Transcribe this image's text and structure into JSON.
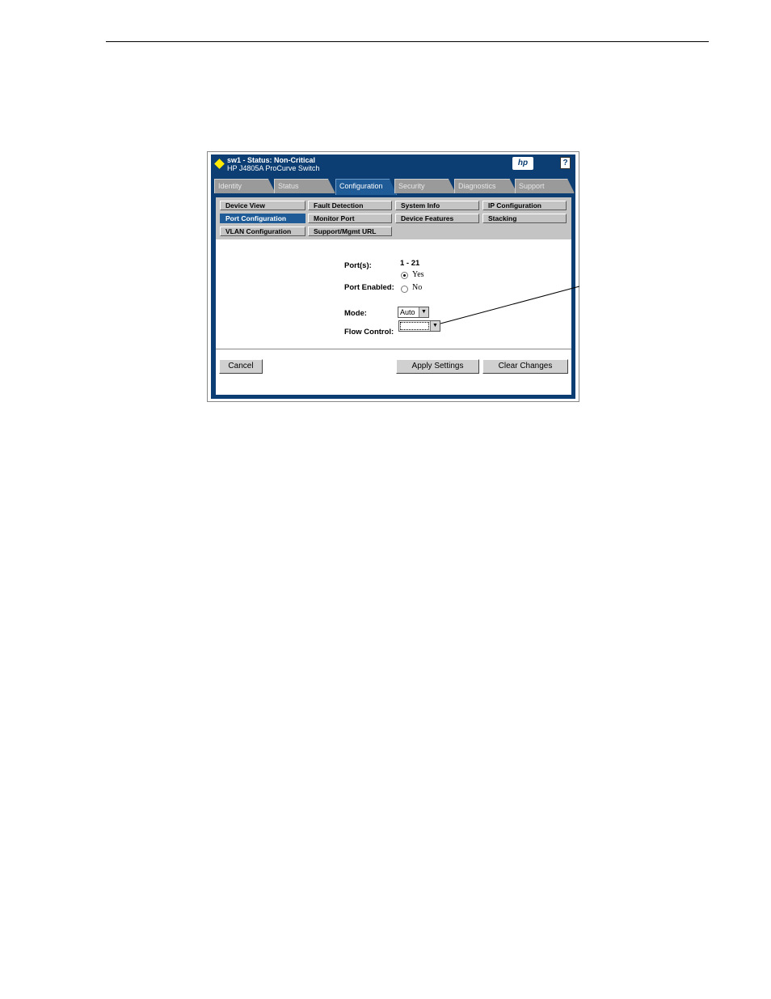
{
  "header": {
    "title": "sw1 - Status: Non-Critical",
    "subtitle": "HP J4805A ProCurve Switch",
    "logo": "hp",
    "help": "?",
    "status_color": "#ffea00"
  },
  "tabs": [
    {
      "label": "Identity",
      "active": false
    },
    {
      "label": "Status",
      "active": false
    },
    {
      "label": "Configuration",
      "active": true
    },
    {
      "label": "Security",
      "active": false
    },
    {
      "label": "Diagnostics",
      "active": false
    },
    {
      "label": "Support",
      "active": false
    }
  ],
  "subnav": [
    {
      "label": "Device View",
      "active": false
    },
    {
      "label": "Fault Detection",
      "active": false
    },
    {
      "label": "System Info",
      "active": false
    },
    {
      "label": "IP Configuration",
      "active": false
    },
    {
      "label": "Port Configuration",
      "active": true
    },
    {
      "label": "Monitor Port",
      "active": false
    },
    {
      "label": "Device Features",
      "active": false
    },
    {
      "label": "Stacking",
      "active": false
    },
    {
      "label": "VLAN Configuration",
      "active": false
    },
    {
      "label": "Support/Mgmt URL",
      "active": false
    }
  ],
  "form": {
    "ports_label": "Port(s):",
    "ports_value": "1 - 21",
    "port_enabled_label": "Port Enabled:",
    "yes_label": "Yes",
    "no_label": "No",
    "mode_label": "Mode:",
    "mode_value": "Auto",
    "flow_control_label": "Flow Control:",
    "flow_control_value": ""
  },
  "buttons": {
    "cancel": "Cancel",
    "apply": "Apply Settings",
    "clear": "Clear Changes"
  },
  "colors": {
    "frame": "#0c3e73",
    "active": "#1f5b96",
    "nav_bg": "#c4c4c4"
  }
}
